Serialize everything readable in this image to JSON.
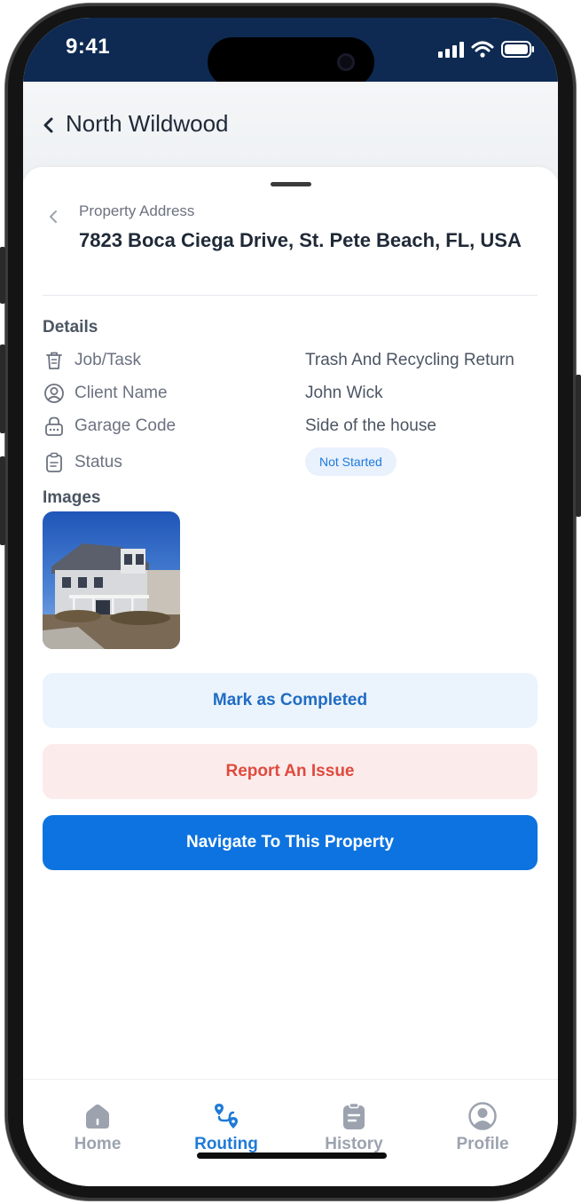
{
  "status_bar": {
    "time": "9:41"
  },
  "header": {
    "title": "North Wildwood"
  },
  "property": {
    "address_label": "Property Address",
    "address": "7823 Boca Ciega Drive, St. Pete Beach, FL, USA"
  },
  "details": {
    "title": "Details",
    "rows": [
      {
        "label": "Job/Task",
        "value": "Trash And Recycling Return"
      },
      {
        "label": "Client Name",
        "value": "John Wick"
      },
      {
        "label": "Garage Code",
        "value": "Side of the house"
      },
      {
        "label": "Status",
        "value": "Not Started"
      }
    ]
  },
  "images": {
    "title": "Images"
  },
  "actions": {
    "complete": "Mark as Completed",
    "issue": "Report An Issue",
    "navigate": "Navigate To This Property"
  },
  "bottom_nav": {
    "items": [
      {
        "label": "Home",
        "icon": "home-icon"
      },
      {
        "label": "Routing",
        "icon": "routing-icon",
        "active": true
      },
      {
        "label": "History",
        "icon": "history-icon"
      },
      {
        "label": "Profile",
        "icon": "profile-icon"
      }
    ]
  },
  "colors": {
    "status_bar": "#0e2a52",
    "primary": "#0d73e0",
    "danger": "#e04a3f",
    "active_tab": "#1f7bd6"
  }
}
